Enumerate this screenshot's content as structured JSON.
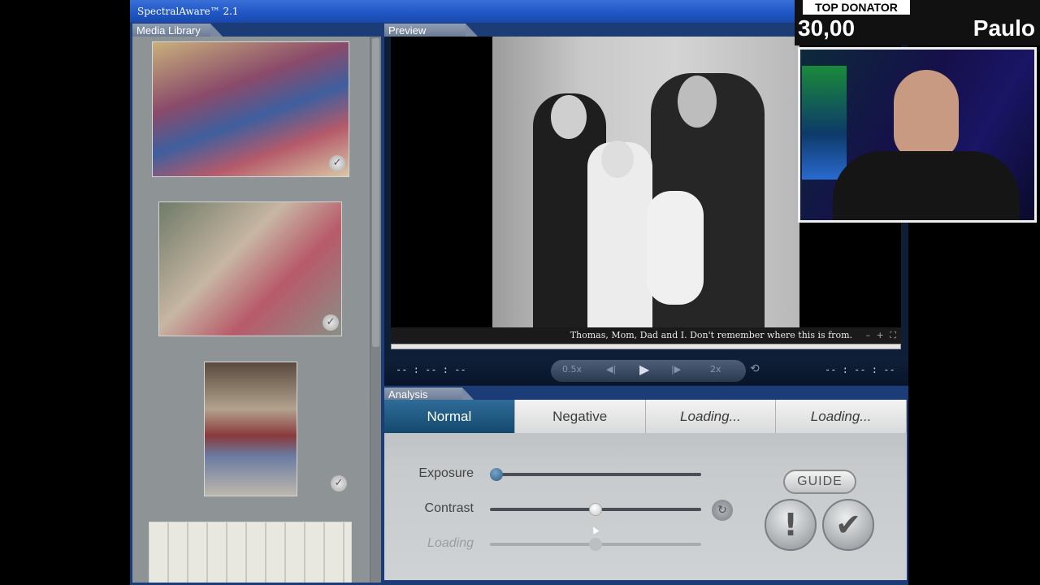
{
  "app": {
    "title": "SpectralAware™ 2.1"
  },
  "library": {
    "tab_label": "Media Library",
    "items": [
      {
        "checked": true
      },
      {
        "checked": true
      },
      {
        "checked": true
      },
      {
        "checked": false
      }
    ]
  },
  "preview": {
    "tab_label": "Preview",
    "caption": "Thomas, Mom, Dad and I. Don't remember where this is from.",
    "caption_controls": "– + ⛶",
    "time_left": "-- : -- : --",
    "time_right": "-- : -- : --",
    "speed_slow": "0.5x",
    "speed_fast": "2x",
    "prev_icon": "◀|",
    "play_icon": "▶",
    "next_icon": "|▶",
    "loop_icon": "⟲"
  },
  "analysis": {
    "tab_label": "Analysis",
    "tabs": [
      "Normal",
      "Negative",
      "Loading...",
      "Loading..."
    ],
    "active_tab": 0,
    "sliders": [
      {
        "label": "Exposure",
        "value": 0.03
      },
      {
        "label": "Contrast",
        "value": 0.5
      },
      {
        "label": "Loading",
        "value": 0.5
      }
    ],
    "guide_label": "GUIDE",
    "warn_label": "!",
    "accept_label": "✔",
    "reset_icon": "↻"
  },
  "stream_overlay": {
    "title": "TOP DONATOR",
    "amount": "30,00",
    "name": "Paulo"
  }
}
